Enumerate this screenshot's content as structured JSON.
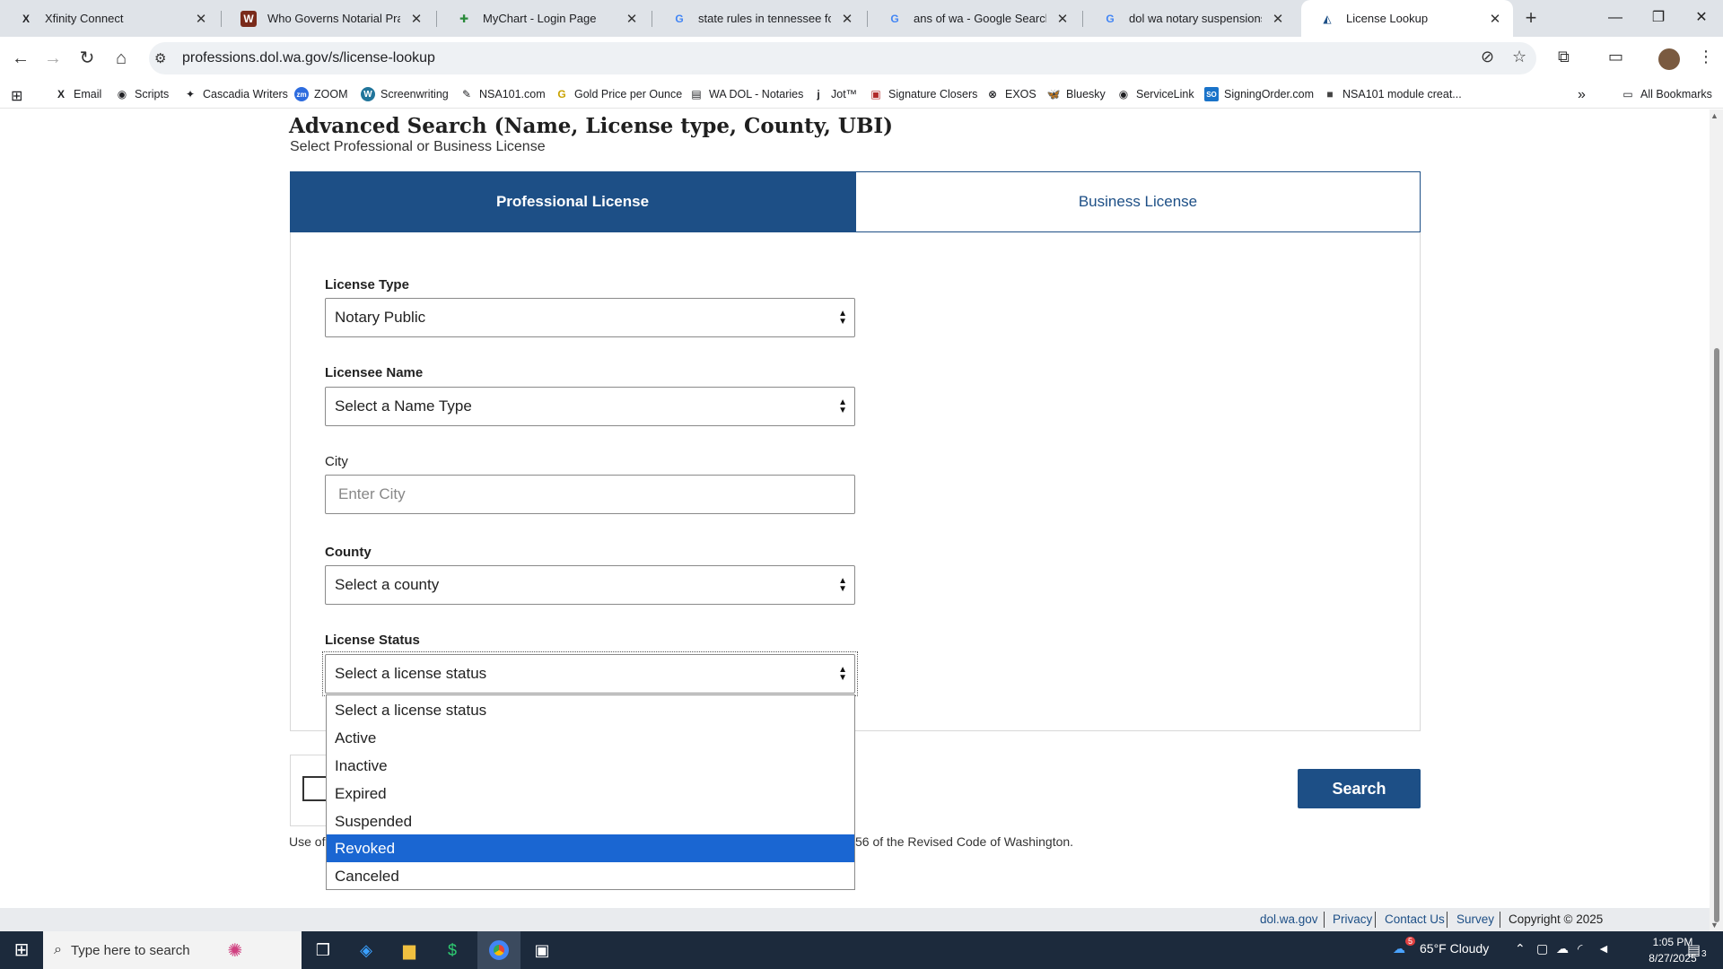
{
  "browser": {
    "tabs": [
      {
        "title": "Xfinity Connect",
        "icon": "X"
      },
      {
        "title": "Who Governs Notarial Practices",
        "icon": "W"
      },
      {
        "title": "MyChart - Login Page",
        "icon": "✚"
      },
      {
        "title": "state rules in tennessee for iden",
        "icon": "G"
      },
      {
        "title": "ans of wa - Google Search",
        "icon": "G"
      },
      {
        "title": "dol wa notary suspensions and r",
        "icon": "G"
      },
      {
        "title": "License Lookup",
        "icon": "◭"
      }
    ],
    "new_tab": "+",
    "url": "professions.dol.wa.gov/s/license-lookup",
    "bookmarks": [
      {
        "label": "Email",
        "icon": "X"
      },
      {
        "label": "Scripts",
        "icon": "◉"
      },
      {
        "label": "Cascadia Writers",
        "icon": "✦"
      },
      {
        "label": "ZOOM",
        "icon": "zm"
      },
      {
        "label": "Screenwriting",
        "icon": "W"
      },
      {
        "label": "NSA101.com",
        "icon": "✎"
      },
      {
        "label": "Gold Price per Ounce",
        "icon": "G"
      },
      {
        "label": "WA DOL - Notaries",
        "icon": "▤"
      },
      {
        "label": "Jot™",
        "icon": "j"
      },
      {
        "label": "Signature Closers",
        "icon": "▣"
      },
      {
        "label": "EXOS",
        "icon": "⊗"
      },
      {
        "label": "Bluesky",
        "icon": "🦋"
      },
      {
        "label": "ServiceLink",
        "icon": "◉"
      },
      {
        "label": "SigningOrder.com",
        "icon": "SO"
      },
      {
        "label": "NSA101 module creat...",
        "icon": "■"
      }
    ],
    "all_bookmarks": "All Bookmarks",
    "more_bookmarks": "»"
  },
  "page": {
    "heading": "Advanced Search (Name, License type, County, UBI)",
    "subheading": "Select Professional or Business License",
    "tab_professional": "Professional License",
    "tab_business": "Business License",
    "license_type_label": "License Type",
    "license_type_value": "Notary Public",
    "licensee_name_label": "Licensee Name",
    "licensee_name_value": "Select a Name Type",
    "city_label": "City",
    "city_placeholder": "Enter City",
    "county_label": "County",
    "county_value": "Select a county",
    "license_status_label": "License Status",
    "license_status_value": "Select a license status",
    "status_options": [
      "Select a license status",
      "Active",
      "Inactive",
      "Expired",
      "Suspended",
      "Revoked",
      "Canceled"
    ],
    "highlighted_option": "Revoked",
    "search_button": "Search",
    "use_text_start": "Use of",
    "use_text_end": "56 of the Revised Code of Washington."
  },
  "footer": {
    "links": [
      "dol.wa.gov",
      "Privacy",
      "Contact Us",
      "Survey"
    ],
    "copyright": "Copyright © 2025"
  },
  "taskbar": {
    "search_placeholder": "Type here to search",
    "weather": "65°F  Cloudy",
    "weather_badge": "5",
    "time": "1:05 PM",
    "date": "8/27/2025",
    "notifications": "3"
  },
  "colors": {
    "brand_blue": "#1d4f86",
    "dropdown_highlight": "#1a66d2"
  }
}
